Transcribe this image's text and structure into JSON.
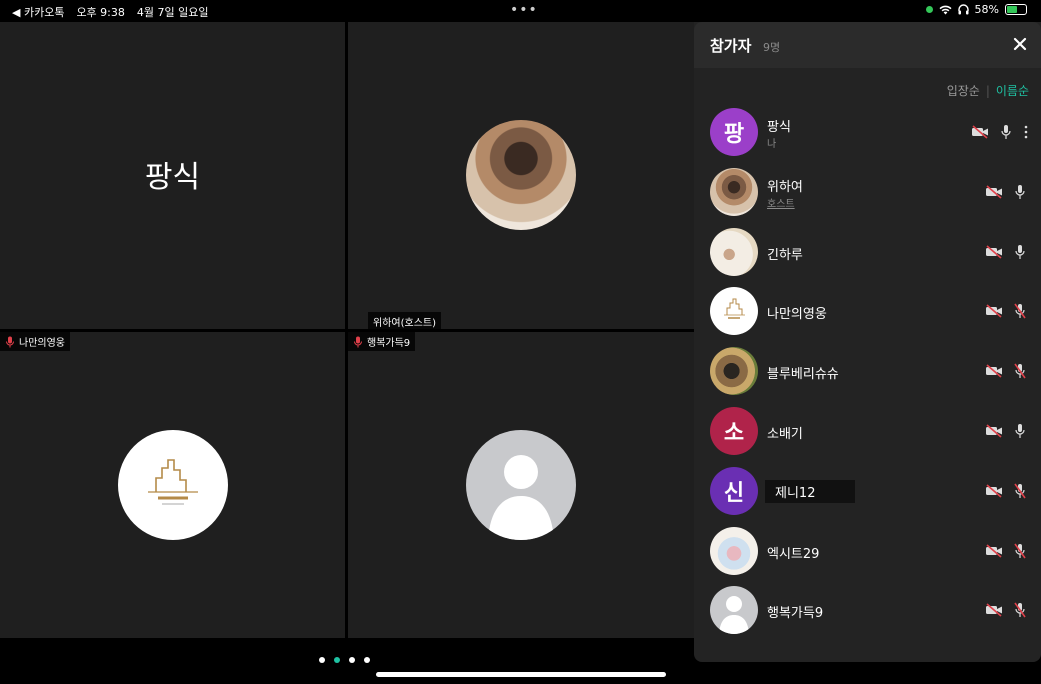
{
  "statusbar": {
    "back_app": "◀ 카카오톡",
    "time": "오후 9:38",
    "date": "4월 7일 일요일",
    "dots": "•••",
    "battery_pct": "58%",
    "battery_level": 0.58
  },
  "grid": {
    "tile1_name": "팡식",
    "tile2_label": "위하여(호스트)",
    "tile3_label": "나만의영웅",
    "tile4_label": "행복가득9"
  },
  "pager": {
    "pages": 4,
    "active": 1
  },
  "panel": {
    "title": "참가자",
    "count": "9명",
    "sort_entry": "입장순",
    "sort_name": "이름순",
    "participants": [
      {
        "name": "팡식",
        "sub": "나",
        "avatar_text": "팡",
        "avatar_color": "#9b3fc9",
        "mic_muted": false
      },
      {
        "name": "위하여",
        "sub": "호스트",
        "avatar_text": "",
        "mic_muted": false
      },
      {
        "name": "긴하루",
        "sub": "",
        "avatar_text": "",
        "mic_muted": false
      },
      {
        "name": "나만의영웅",
        "sub": "",
        "avatar_text": "",
        "mic_muted": true
      },
      {
        "name": "블루베리슈슈",
        "sub": "",
        "avatar_text": "",
        "mic_muted": true
      },
      {
        "name": "소배기",
        "sub": "",
        "avatar_text": "소",
        "avatar_color": "#b0234a",
        "mic_muted": false
      },
      {
        "name": "제니12",
        "sub": "",
        "avatar_text": "신",
        "avatar_color": "#6a2fb3",
        "mic_muted": true
      },
      {
        "name": "엑시트29",
        "sub": "",
        "avatar_text": "",
        "mic_muted": true
      },
      {
        "name": "행복가득9",
        "sub": "",
        "avatar_text": "",
        "mic_muted": true
      }
    ]
  },
  "colors": {
    "accent": "#1fc2a3",
    "muted_red": "#e0404a"
  }
}
